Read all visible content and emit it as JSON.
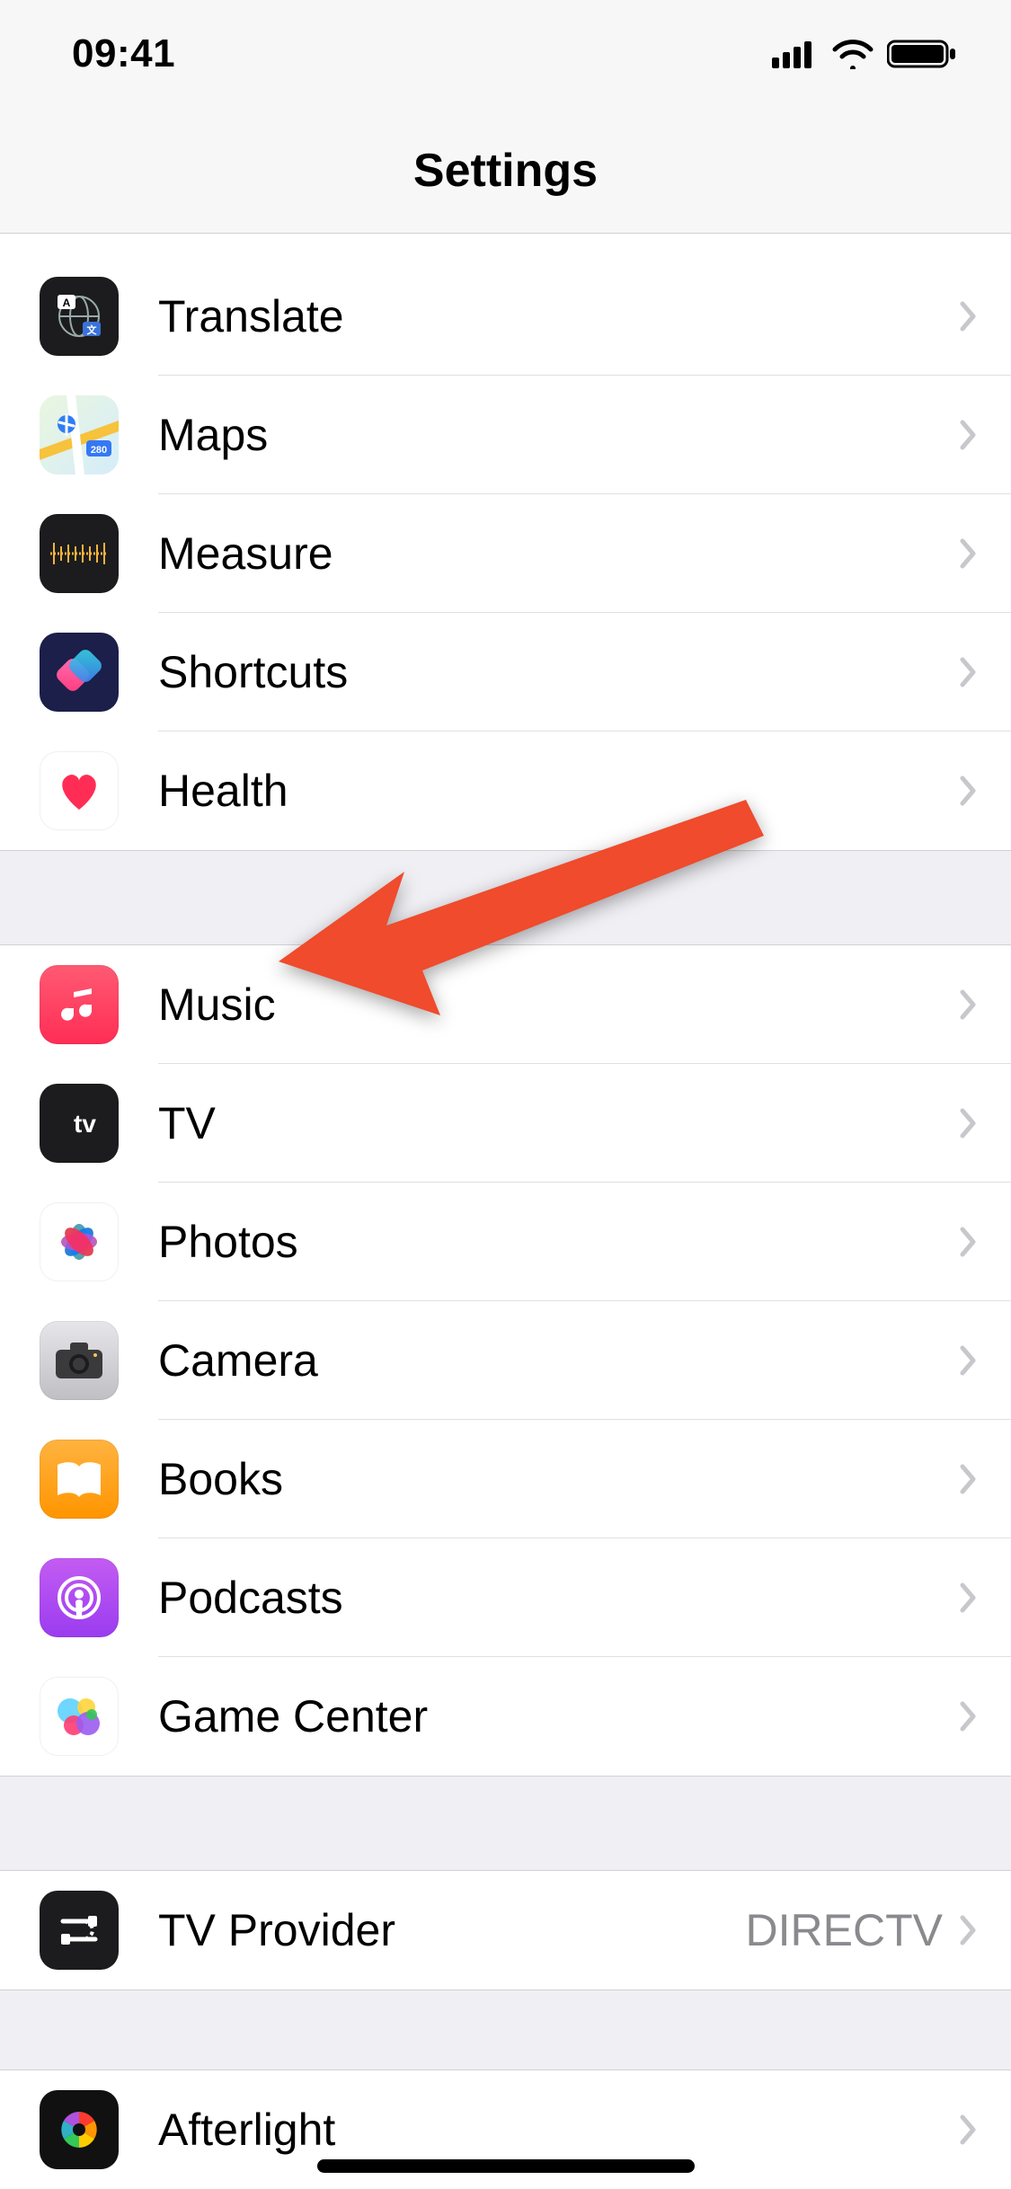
{
  "status": {
    "time": "09:41"
  },
  "nav": {
    "title": "Settings"
  },
  "groups": [
    {
      "id": "apple-apps-1",
      "rows": [
        {
          "id": "translate",
          "label": "Translate",
          "icon": "translate-icon"
        },
        {
          "id": "maps",
          "label": "Maps",
          "icon": "maps-icon"
        },
        {
          "id": "measure",
          "label": "Measure",
          "icon": "measure-icon"
        },
        {
          "id": "shortcuts",
          "label": "Shortcuts",
          "icon": "shortcuts-icon"
        },
        {
          "id": "health",
          "label": "Health",
          "icon": "health-icon"
        }
      ]
    },
    {
      "id": "apple-apps-2",
      "rows": [
        {
          "id": "music",
          "label": "Music",
          "icon": "music-icon"
        },
        {
          "id": "tv",
          "label": "TV",
          "icon": "tv-icon"
        },
        {
          "id": "photos",
          "label": "Photos",
          "icon": "photos-icon"
        },
        {
          "id": "camera",
          "label": "Camera",
          "icon": "camera-icon"
        },
        {
          "id": "books",
          "label": "Books",
          "icon": "books-icon"
        },
        {
          "id": "podcasts",
          "label": "Podcasts",
          "icon": "podcasts-icon"
        },
        {
          "id": "gamecenter",
          "label": "Game Center",
          "icon": "gamecenter-icon"
        }
      ]
    },
    {
      "id": "tv-provider",
      "rows": [
        {
          "id": "tvprovider",
          "label": "TV Provider",
          "icon": "tvprovider-icon",
          "detail": "DIRECTV"
        }
      ]
    },
    {
      "id": "third-party",
      "rows": [
        {
          "id": "afterlight",
          "label": "Afterlight",
          "icon": "afterlight-icon"
        }
      ]
    }
  ],
  "annotation": {
    "arrow_points_to": "music"
  }
}
